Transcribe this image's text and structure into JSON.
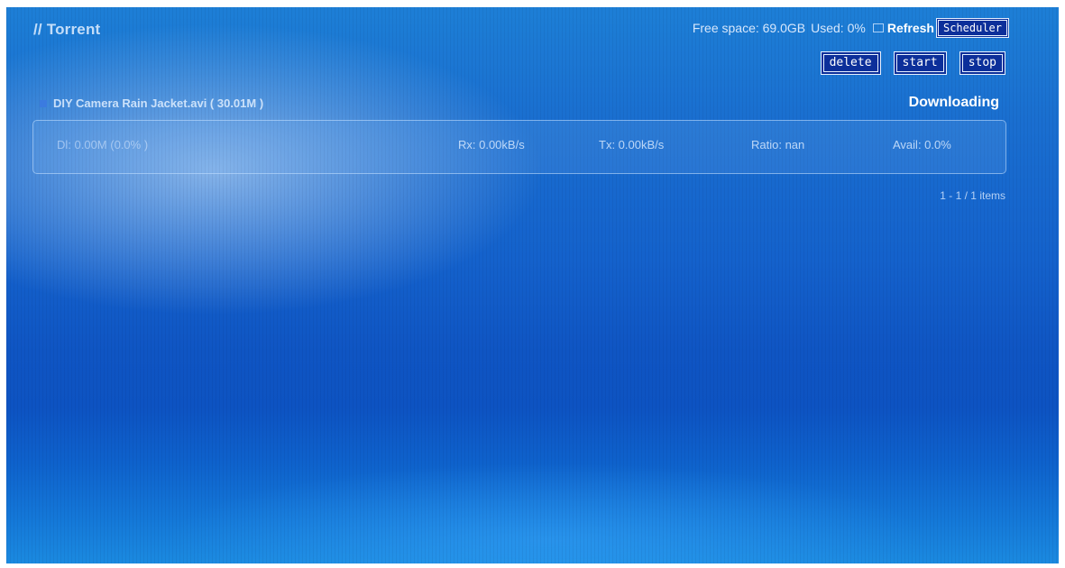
{
  "app": {
    "title": "// Torrent"
  },
  "status": {
    "free_space": "Free space: 69.0GB",
    "used": "Used: 0%",
    "refresh_label": "Refresh",
    "scheduler_label": "Scheduler"
  },
  "actions": {
    "delete_label": "delete",
    "start_label": "start",
    "stop_label": "stop"
  },
  "torrents": [
    {
      "name": "DIY Camera Rain Jacket.avi ( 30.01M )",
      "state": "Downloading",
      "dl": "Dl: 0.00M (0.0% )",
      "rx": "Rx: 0.00kB/s",
      "tx": "Tx: 0.00kB/s",
      "ratio": "Ratio: nan",
      "avail": "Avail: 0.0%"
    }
  ],
  "pager": {
    "text": "1 - 1 / 1 items"
  },
  "colors": {
    "background": "#1462cc",
    "button_bg": "#0c2f9a",
    "item_marker": "#3b7be0"
  }
}
